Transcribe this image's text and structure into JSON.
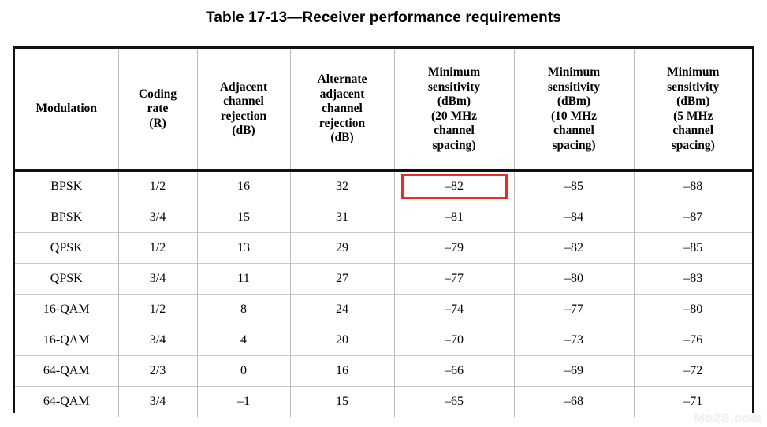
{
  "page": {
    "title": "Table 17-13—Receiver performance requirements",
    "watermark": "Mo2S.com",
    "highlight_color": "#ee2a24",
    "border_color": "#111111",
    "grid_color": "#b9b9b9"
  },
  "table": {
    "headers": [
      "Modulation",
      "Coding\nrate\n(R)",
      "Adjacent\nchannel\nrejection\n(dB)",
      "Alternate\nadjacent\nchannel\nrejection\n(dB)",
      "Minimum\nsensitivity\n(dBm)\n(20 MHz\nchannel\nspacing)",
      "Minimum\nsensitivity\n(dBm)\n(10 MHz\nchannel\nspacing)",
      "Minimum\nsensitivity\n(dBm)\n(5 MHz\nchannel\nspacing)"
    ],
    "header_lines": [
      [
        "Modulation"
      ],
      [
        "Coding",
        "rate",
        "(R)"
      ],
      [
        "Adjacent",
        "channel",
        "rejection",
        "(dB)"
      ],
      [
        "Alternate",
        "adjacent",
        "channel",
        "rejection",
        "(dB)"
      ],
      [
        "Minimum",
        "sensitivity",
        "(dBm)",
        "(20 MHz",
        "channel",
        "spacing)"
      ],
      [
        "Minimum",
        "sensitivity",
        "(dBm)",
        "(10 MHz",
        "channel",
        "spacing)"
      ],
      [
        "Minimum",
        "sensitivity",
        "(dBm)",
        "(5 MHz",
        "channel",
        "spacing)"
      ]
    ],
    "rows": [
      {
        "modulation": "BPSK",
        "coding_rate": "1/2",
        "adjacent_rejection": "16",
        "alternate_rejection": "32",
        "sens_20mhz": "–82",
        "sens_10mhz": "–85",
        "sens_5mhz": "–88"
      },
      {
        "modulation": "BPSK",
        "coding_rate": "3/4",
        "adjacent_rejection": "15",
        "alternate_rejection": "31",
        "sens_20mhz": "–81",
        "sens_10mhz": "–84",
        "sens_5mhz": "–87"
      },
      {
        "modulation": "QPSK",
        "coding_rate": "1/2",
        "adjacent_rejection": "13",
        "alternate_rejection": "29",
        "sens_20mhz": "–79",
        "sens_10mhz": "–82",
        "sens_5mhz": "–85"
      },
      {
        "modulation": "QPSK",
        "coding_rate": "3/4",
        "adjacent_rejection": "11",
        "alternate_rejection": "27",
        "sens_20mhz": "–77",
        "sens_10mhz": "–80",
        "sens_5mhz": "–83"
      },
      {
        "modulation": "16-QAM",
        "coding_rate": "1/2",
        "adjacent_rejection": "8",
        "alternate_rejection": "24",
        "sens_20mhz": "–74",
        "sens_10mhz": "–77",
        "sens_5mhz": "–80"
      },
      {
        "modulation": "16-QAM",
        "coding_rate": "3/4",
        "adjacent_rejection": "4",
        "alternate_rejection": "20",
        "sens_20mhz": "–70",
        "sens_10mhz": "–73",
        "sens_5mhz": "–76"
      },
      {
        "modulation": "64-QAM",
        "coding_rate": "2/3",
        "adjacent_rejection": "0",
        "alternate_rejection": "16",
        "sens_20mhz": "–66",
        "sens_10mhz": "–69",
        "sens_5mhz": "–72"
      },
      {
        "modulation": "64-QAM",
        "coding_rate": "3/4",
        "adjacent_rejection": "–1",
        "alternate_rejection": "15",
        "sens_20mhz": "–65",
        "sens_10mhz": "–68",
        "sens_5mhz": "–71"
      }
    ],
    "highlighted_cell": {
      "row": 0,
      "column": "sens_20mhz",
      "value": "–82"
    }
  }
}
